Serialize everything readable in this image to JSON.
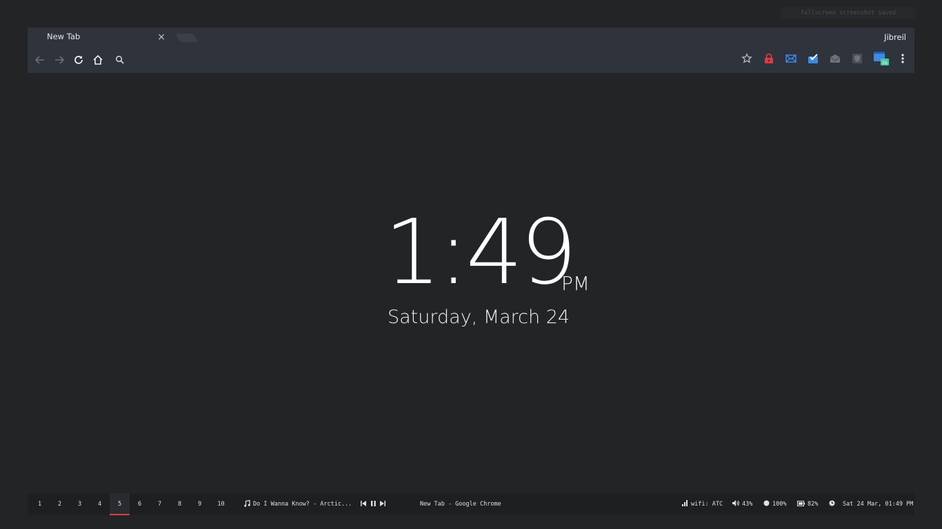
{
  "notification": "fullscreen screenshot saved",
  "browser": {
    "tab_title": "New Tab",
    "tab_close": "×",
    "profile_name": "Jibreil"
  },
  "clock": {
    "time": "1:49",
    "ampm": "PM",
    "date": "Saturday, March 24"
  },
  "statusbar": {
    "workspaces": [
      "1",
      "2",
      "3",
      "4",
      "5",
      "6",
      "7",
      "8",
      "9",
      "10"
    ],
    "active_workspace": "5",
    "music": "Do I Wanna Know? - Arctic...",
    "window_title": "New Tab - Google Chrome",
    "wifi": "wifi: ATC",
    "volume": "43%",
    "brightness": "100%",
    "battery": "82%",
    "datetime": "Sat 24 Mar, 01:49 PM"
  },
  "colors": {
    "background": "#232426",
    "browser_chrome": "#2f333b",
    "active_workspace_underline": "#d6433e",
    "lock_extension": "#e0393e",
    "mail_extension": "#3b8ae6"
  },
  "icons": [
    "back-icon",
    "forward-icon",
    "reload-icon",
    "home-icon",
    "search-icon",
    "star-icon",
    "lock-extension-icon",
    "mail-extension-icon",
    "inbox-check-icon",
    "mail-gray-icon",
    "shield-icon",
    "window-extension-icon",
    "menu-dots-icon",
    "music-note-icon",
    "prev-icon",
    "pause-icon",
    "next-icon",
    "signal-icon",
    "volume-icon",
    "brightness-icon",
    "battery-icon",
    "clock-icon"
  ]
}
